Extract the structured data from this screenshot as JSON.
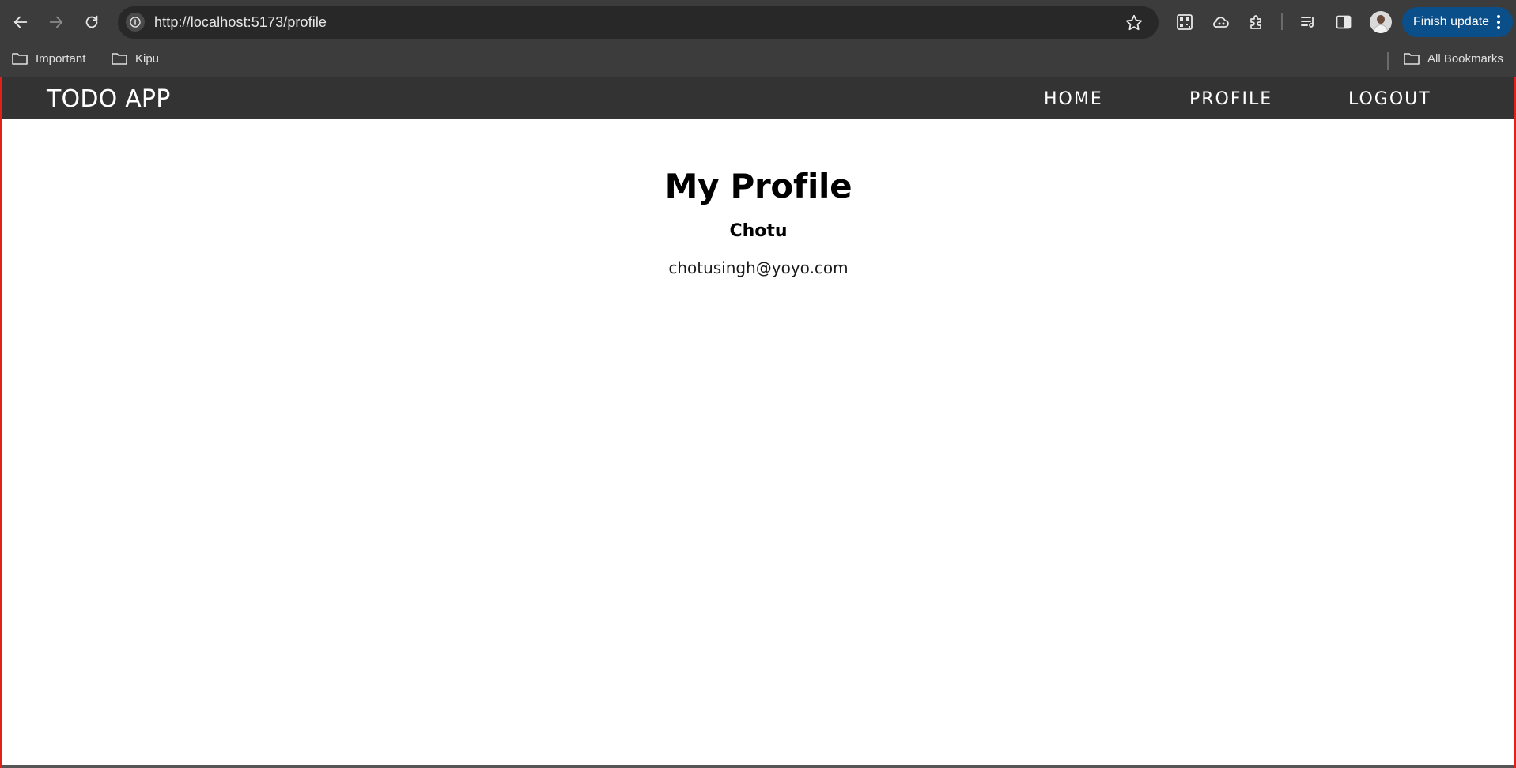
{
  "browser": {
    "url": "http://localhost:5173/profile",
    "finish_update_label": "Finish update",
    "bookmarks": [
      {
        "label": "Important"
      },
      {
        "label": "Kipu"
      }
    ],
    "all_bookmarks_label": "All Bookmarks",
    "accent_color": "#0b4f8a"
  },
  "app": {
    "brand": "TODO APP",
    "nav": {
      "home": "HOME",
      "profile": "PROFILE",
      "logout": "LOGOUT"
    }
  },
  "profile": {
    "title": "My Profile",
    "name": "Chotu",
    "email": "chotusingh@yoyo.com"
  }
}
